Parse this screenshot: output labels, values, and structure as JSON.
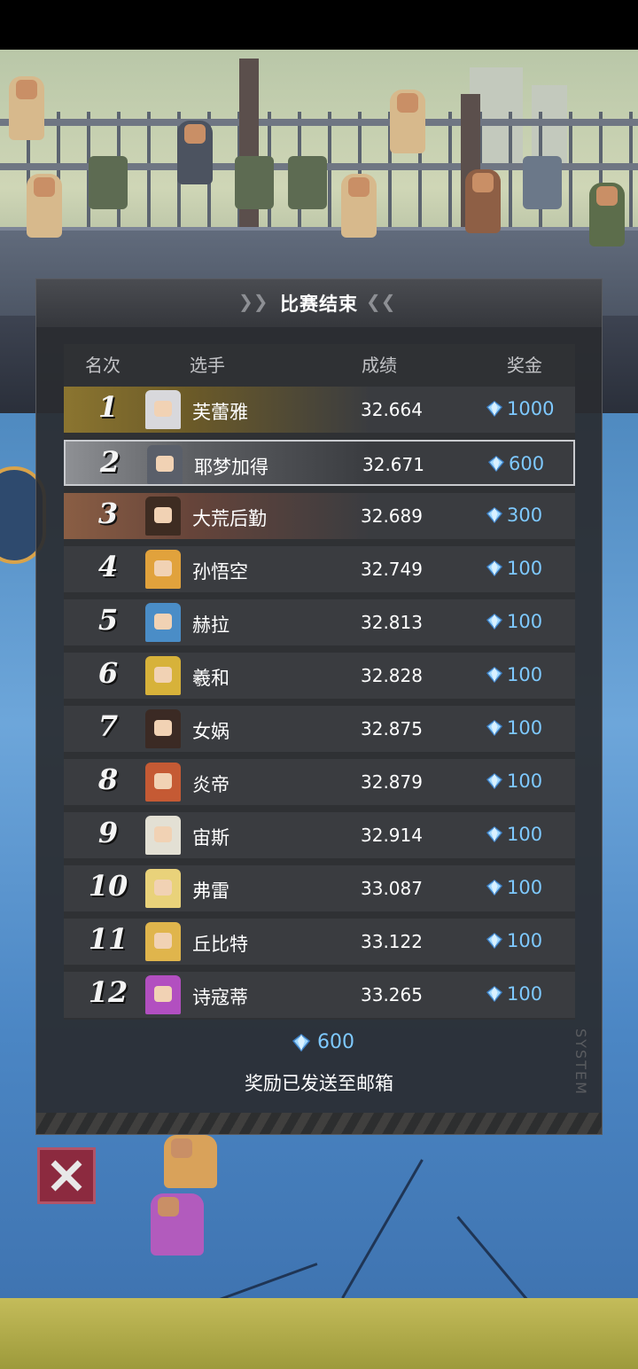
{
  "panel": {
    "title": "比赛结束",
    "columns": {
      "rank": "名次",
      "player": "选手",
      "score": "成绩",
      "prize": "奖金"
    },
    "rows": [
      {
        "rank": "1",
        "name": "芙蕾雅",
        "score": "32.664",
        "prize": "1000",
        "tier": "gold",
        "avatar_color": "#d8d8dc"
      },
      {
        "rank": "2",
        "name": "耶梦加得",
        "score": "32.671",
        "prize": "600",
        "tier": "silver",
        "avatar_color": "#5a5f6a"
      },
      {
        "rank": "3",
        "name": "大荒后勤",
        "score": "32.689",
        "prize": "300",
        "tier": "bronze",
        "avatar_color": "#3e2c22"
      },
      {
        "rank": "4",
        "name": "孙悟空",
        "score": "32.749",
        "prize": "100",
        "tier": "normal",
        "avatar_color": "#e1a23c"
      },
      {
        "rank": "5",
        "name": "赫拉",
        "score": "32.813",
        "prize": "100",
        "tier": "normal",
        "avatar_color": "#4a8dc7"
      },
      {
        "rank": "6",
        "name": "羲和",
        "score": "32.828",
        "prize": "100",
        "tier": "normal",
        "avatar_color": "#d7b23a"
      },
      {
        "rank": "7",
        "name": "女娲",
        "score": "32.875",
        "prize": "100",
        "tier": "normal",
        "avatar_color": "#3b2a24"
      },
      {
        "rank": "8",
        "name": "炎帝",
        "score": "32.879",
        "prize": "100",
        "tier": "normal",
        "avatar_color": "#c55a34"
      },
      {
        "rank": "9",
        "name": "宙斯",
        "score": "32.914",
        "prize": "100",
        "tier": "normal",
        "avatar_color": "#e3e0d4"
      },
      {
        "rank": "10",
        "name": "弗雷",
        "score": "33.087",
        "prize": "100",
        "tier": "normal",
        "avatar_color": "#e9d27a"
      },
      {
        "rank": "11",
        "name": "丘比特",
        "score": "33.122",
        "prize": "100",
        "tier": "normal",
        "avatar_color": "#e0b54c"
      },
      {
        "rank": "12",
        "name": "诗寇蒂",
        "score": "33.265",
        "prize": "100",
        "tier": "normal",
        "avatar_color": "#b24fc0"
      }
    ],
    "total_reward": "600",
    "notice": "奖励已发送至邮箱",
    "watermark": "SYSTEM"
  },
  "icons": {
    "gem": "diamond-gem-icon",
    "close": "close-icon"
  },
  "colors": {
    "prize_text": "#7ec9ff",
    "close_button": "#8c2a3f"
  }
}
